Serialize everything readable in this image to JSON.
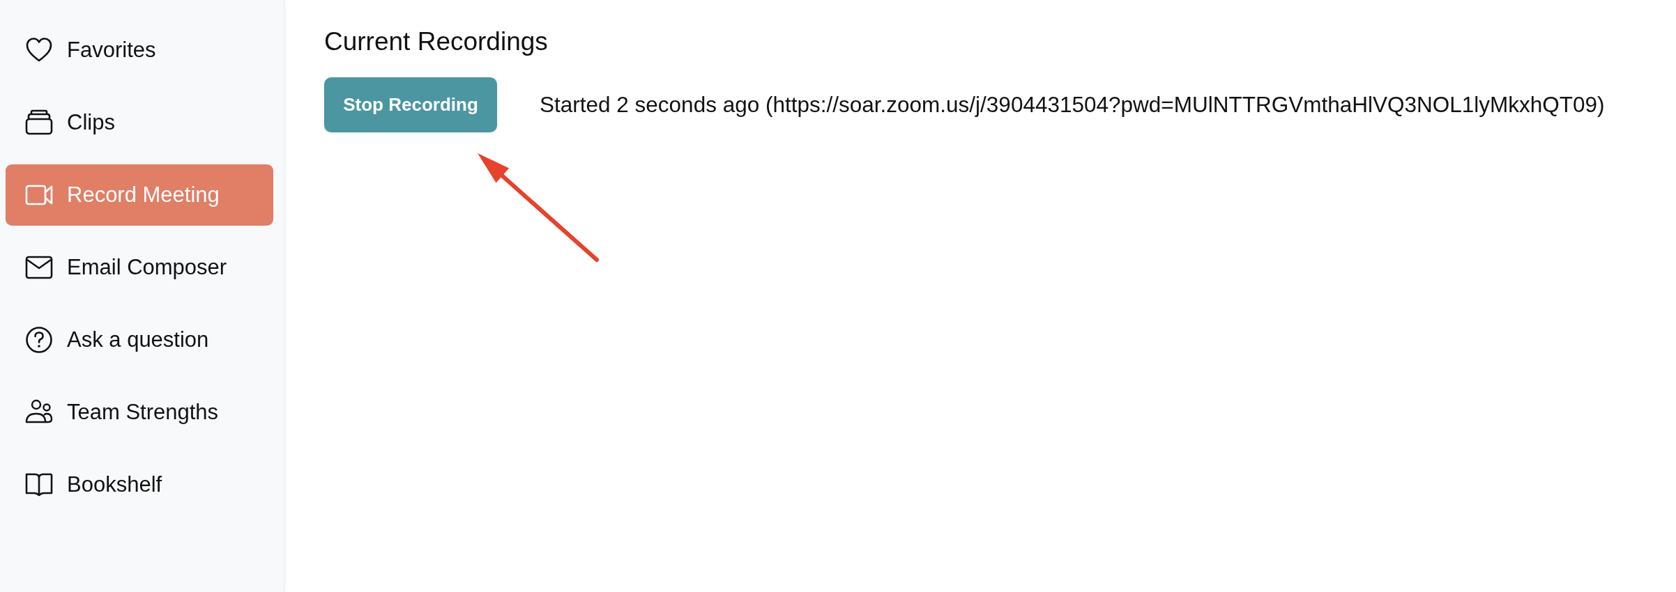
{
  "sidebar": {
    "items": [
      {
        "label": "Favorites",
        "selected": false
      },
      {
        "label": "Clips",
        "selected": false
      },
      {
        "label": "Record Meeting",
        "selected": true
      },
      {
        "label": "Email Composer",
        "selected": false
      },
      {
        "label": "Ask a question",
        "selected": false
      },
      {
        "label": "Team Strengths",
        "selected": false
      },
      {
        "label": "Bookshelf",
        "selected": false
      }
    ]
  },
  "main": {
    "title": "Current Recordings",
    "recordings": [
      {
        "button": "Stop Recording",
        "status": "Started 2 seconds ago (https://soar.zoom.us/j/3904431504?pwd=MUlNTTRGVmthaHlVQ3NOL1lyMkxhQT09)"
      }
    ]
  },
  "annotations": [
    {
      "kind": "arrow"
    }
  ]
}
